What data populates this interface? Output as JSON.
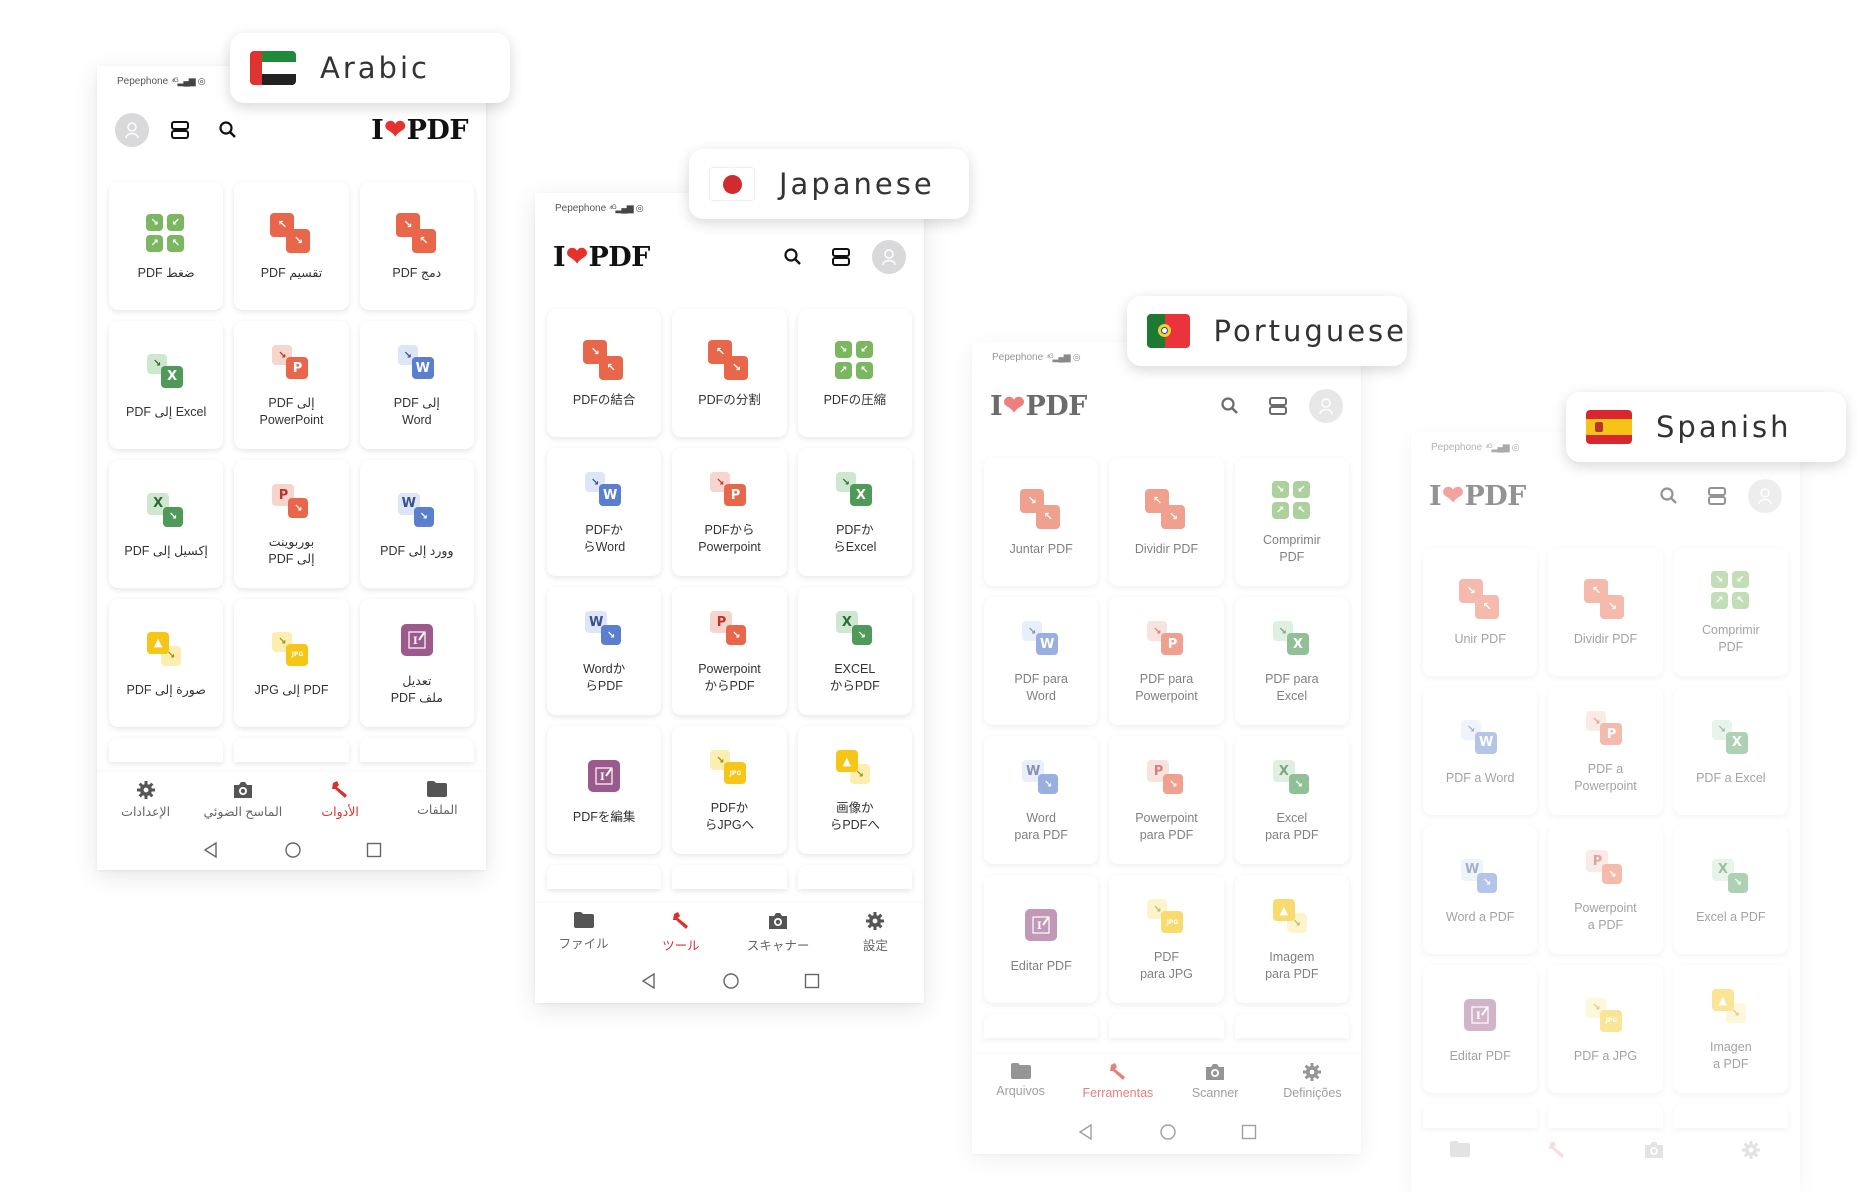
{
  "colors": {
    "accent_red": "#e5322d",
    "orange": "#e8674a",
    "green": "#7bb661",
    "green_dark": "#4f9a59",
    "blue": "#5b7fcf",
    "yellow": "#f5c518",
    "purple": "#9c5a8c"
  },
  "icons": {
    "search": "search-icon",
    "layout": "layout-toggle-icon",
    "avatar": "user-avatar-icon",
    "files": "folder-icon",
    "tools": "wrench-icon",
    "scanner": "camera-icon",
    "settings": "gear-icon"
  },
  "screens": [
    {
      "language": "Arabic",
      "flag": "uae",
      "carrier": "Pepephone",
      "signal": "4G",
      "logo": {
        "left": "I",
        "right": "PDF"
      },
      "tools": [
        {
          "label": "ضغط PDF",
          "icon": "compress"
        },
        {
          "label": "تقسيم PDF",
          "icon": "split"
        },
        {
          "label": "دمج PDF",
          "icon": "merge"
        },
        {
          "label": "Excel إلى PDF",
          "icon": "pdf-to-excel"
        },
        {
          "label": "إلى PDF\nPowerPoint",
          "icon": "pdf-to-ppt"
        },
        {
          "label": "إلى PDF\nWord",
          "icon": "pdf-to-word"
        },
        {
          "label": "إكسيل إلى PDF",
          "icon": "excel-to-pdf"
        },
        {
          "label": "بوربوينت\nإلى PDF",
          "icon": "ppt-to-pdf"
        },
        {
          "label": "وورد إلى PDF",
          "icon": "word-to-pdf"
        },
        {
          "label": "صورة إلى PDF",
          "icon": "image-to-pdf"
        },
        {
          "label": "PDF إلى JPG",
          "icon": "pdf-to-jpg"
        },
        {
          "label": "تعديل\nملف PDF",
          "icon": "edit-pdf"
        }
      ],
      "nav": [
        {
          "label": "الإعدادات",
          "icon": "settings",
          "active": false
        },
        {
          "label": "الماسح الضوئي",
          "icon": "scanner",
          "active": false
        },
        {
          "label": "الأدوات",
          "icon": "tools",
          "active": true
        },
        {
          "label": "الملفات",
          "icon": "files",
          "active": false
        }
      ]
    },
    {
      "language": "Japanese",
      "flag": "japan",
      "carrier": "Pepephone",
      "signal": "4G",
      "logo": {
        "left": "I",
        "right": "PDF"
      },
      "tools": [
        {
          "label": "PDFの結合",
          "icon": "merge"
        },
        {
          "label": "PDFの分割",
          "icon": "split"
        },
        {
          "label": "PDFの圧縮",
          "icon": "compress"
        },
        {
          "label": "PDFか\nらWord",
          "icon": "pdf-to-word"
        },
        {
          "label": "PDFから\nPowerpoint",
          "icon": "pdf-to-ppt"
        },
        {
          "label": "PDFか\nらExcel",
          "icon": "pdf-to-excel"
        },
        {
          "label": "Wordか\nらPDF",
          "icon": "word-to-pdf"
        },
        {
          "label": "Powerpoint\nからPDF",
          "icon": "ppt-to-pdf"
        },
        {
          "label": "EXCEL\nからPDF",
          "icon": "excel-to-pdf"
        },
        {
          "label": "PDFを編集",
          "icon": "edit-pdf"
        },
        {
          "label": "PDFか\nらJPGへ",
          "icon": "pdf-to-jpg"
        },
        {
          "label": "画像か\nらPDFへ",
          "icon": "image-to-pdf"
        }
      ],
      "nav": [
        {
          "label": "ファイル",
          "icon": "files",
          "active": false
        },
        {
          "label": "ツール",
          "icon": "tools",
          "active": true
        },
        {
          "label": "スキャナー",
          "icon": "scanner",
          "active": false
        },
        {
          "label": "設定",
          "icon": "settings",
          "active": false
        }
      ]
    },
    {
      "language": "Portuguese",
      "flag": "portugal",
      "carrier": "Pepephone",
      "signal": "4G",
      "logo": {
        "left": "I",
        "right": "PDF"
      },
      "tools": [
        {
          "label": "Juntar PDF",
          "icon": "merge"
        },
        {
          "label": "Dividir PDF",
          "icon": "split"
        },
        {
          "label": "Comprimir\nPDF",
          "icon": "compress"
        },
        {
          "label": "PDF para\nWord",
          "icon": "pdf-to-word"
        },
        {
          "label": "PDF para\nPowerpoint",
          "icon": "pdf-to-ppt"
        },
        {
          "label": "PDF para\nExcel",
          "icon": "pdf-to-excel"
        },
        {
          "label": "Word\npara PDF",
          "icon": "word-to-pdf"
        },
        {
          "label": "Powerpoint\npara PDF",
          "icon": "ppt-to-pdf"
        },
        {
          "label": "Excel\npara PDF",
          "icon": "excel-to-pdf"
        },
        {
          "label": "Editar PDF",
          "icon": "edit-pdf"
        },
        {
          "label": "PDF\npara JPG",
          "icon": "pdf-to-jpg"
        },
        {
          "label": "Imagem\npara PDF",
          "icon": "image-to-pdf"
        }
      ],
      "nav": [
        {
          "label": "Arquivos",
          "icon": "files",
          "active": false
        },
        {
          "label": "Ferramentas",
          "icon": "tools",
          "active": true
        },
        {
          "label": "Scanner",
          "icon": "scanner",
          "active": false
        },
        {
          "label": "Definições",
          "icon": "settings",
          "active": false
        }
      ]
    },
    {
      "language": "Spanish",
      "flag": "spain",
      "carrier": "Pepephone",
      "signal": "4G",
      "logo": {
        "left": "I",
        "right": "PDF"
      },
      "tools": [
        {
          "label": "Unir PDF",
          "icon": "merge"
        },
        {
          "label": "Dividir PDF",
          "icon": "split"
        },
        {
          "label": "Comprimir\nPDF",
          "icon": "compress"
        },
        {
          "label": "PDF a Word",
          "icon": "pdf-to-word"
        },
        {
          "label": "PDF a\nPowerpoint",
          "icon": "pdf-to-ppt"
        },
        {
          "label": "PDF a Excel",
          "icon": "pdf-to-excel"
        },
        {
          "label": "Word a PDF",
          "icon": "word-to-pdf"
        },
        {
          "label": "Powerpoint\na PDF",
          "icon": "ppt-to-pdf"
        },
        {
          "label": "Excel a PDF",
          "icon": "excel-to-pdf"
        },
        {
          "label": "Editar PDF",
          "icon": "edit-pdf"
        },
        {
          "label": "PDF a JPG",
          "icon": "pdf-to-jpg"
        },
        {
          "label": "Imagen\na PDF",
          "icon": "image-to-pdf"
        }
      ],
      "nav": [
        {
          "label": "",
          "icon": "files",
          "active": false
        },
        {
          "label": "",
          "icon": "tools",
          "active": true
        },
        {
          "label": "",
          "icon": "scanner",
          "active": false
        },
        {
          "label": "",
          "icon": "settings",
          "active": false
        }
      ]
    }
  ]
}
